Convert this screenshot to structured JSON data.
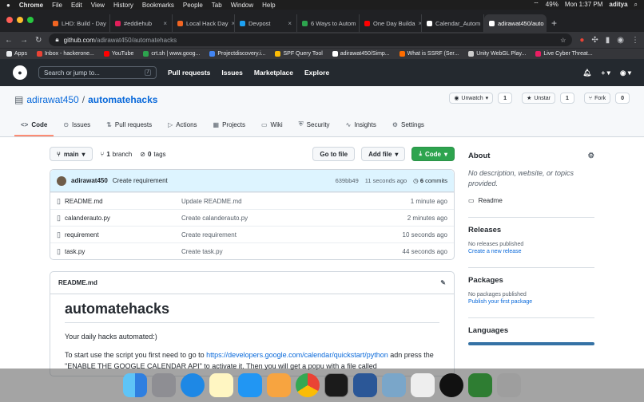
{
  "menubar": {
    "app": "Chrome",
    "items": [
      "File",
      "Edit",
      "View",
      "History",
      "Bookmarks",
      "People",
      "Tab",
      "Window",
      "Help"
    ],
    "battery": "49%",
    "clock": "Mon 1:37 PM",
    "user": "aditya"
  },
  "tabs": [
    {
      "label": "LHD: Build - Day",
      "color": "#f26522"
    },
    {
      "label": "#eddiehub",
      "color": "#e01e5a"
    },
    {
      "label": "Local Hack Day",
      "color": "#f26522"
    },
    {
      "label": "Devpost",
      "color": "#003e54"
    },
    {
      "label": "6 Ways to Autom",
      "color": "#2da44e"
    },
    {
      "label": "One Day Builda",
      "color": "#ff0000"
    },
    {
      "label": "Calendar_Autom",
      "color": "#ffffff"
    },
    {
      "label": "adirawat450/auto",
      "color": "#ffffff",
      "active": true
    }
  ],
  "url": {
    "host": "github.com",
    "path": "/adirawat450/automatehacks"
  },
  "bookmarks": [
    {
      "label": "Apps",
      "color": "#e8eaed"
    },
    {
      "label": "Inbox - hackerone...",
      "color": "#ea4335"
    },
    {
      "label": "YouTube",
      "color": "#ff0000"
    },
    {
      "label": "crt.sh | www.goog...",
      "color": "#2da44e"
    },
    {
      "label": "Projectdiscovery.i...",
      "color": "#4285f4"
    },
    {
      "label": "SPF Query Tool",
      "color": "#fbbc05"
    },
    {
      "label": "adirawat450/Simp...",
      "color": "#ffffff"
    },
    {
      "label": "What is SSRF (Ser...",
      "color": "#ff6d00"
    },
    {
      "label": "Unity WebGL Play...",
      "color": "#cccccc"
    },
    {
      "label": "Live Cyber Threat...",
      "color": "#e91e63"
    }
  ],
  "github": {
    "search_placeholder": "Search or jump to...",
    "search_key": "/",
    "nav": [
      "Pull requests",
      "Issues",
      "Marketplace",
      "Explore"
    ],
    "plus": "+"
  },
  "repo": {
    "owner": "adirawat450",
    "name": "automatehacks",
    "watch": "Unwatch",
    "watch_count": "1",
    "star": "Unstar",
    "star_count": "1",
    "fork": "Fork",
    "fork_count": "0"
  },
  "repo_tabs": [
    {
      "label": "Code",
      "icon": "<>",
      "active": true
    },
    {
      "label": "Issues",
      "icon": "⊙"
    },
    {
      "label": "Pull requests",
      "icon": "⇅"
    },
    {
      "label": "Actions",
      "icon": "▷"
    },
    {
      "label": "Projects",
      "icon": "▦"
    },
    {
      "label": "Wiki",
      "icon": "▭"
    },
    {
      "label": "Security",
      "icon": "⛨"
    },
    {
      "label": "Insights",
      "icon": "∿"
    },
    {
      "label": "Settings",
      "icon": "⚙"
    }
  ],
  "branchbar": {
    "branch": "main",
    "branches_count": "1",
    "branches_label": "branch",
    "tags_count": "0",
    "tags_label": "tags",
    "goto": "Go to file",
    "add": "Add file",
    "code": "Code"
  },
  "commit": {
    "author": "adirawat450",
    "message": "Create requirement",
    "sha": "639bb49",
    "time": "11 seconds ago",
    "count": "6",
    "count_label": "commits"
  },
  "files": [
    {
      "name": "README.md",
      "msg": "Update README.md",
      "time": "1 minute ago"
    },
    {
      "name": "calanderauto.py",
      "msg": "Create calanderauto.py",
      "time": "2 minutes ago"
    },
    {
      "name": "requirement",
      "msg": "Create requirement",
      "time": "10 seconds ago"
    },
    {
      "name": "task.py",
      "msg": "Create task.py",
      "time": "44 seconds ago"
    }
  ],
  "readme": {
    "file": "README.md",
    "title": "automatehacks",
    "p1": "Your daily hacks automated:)",
    "p2a": "To start use the script you first need to go to ",
    "p2link": "https://developers.google.com/calendar/quickstart/python",
    "p2b": " adn press the \"ENABLE THE GOOGLE CALENDAR API\" to activate it. Then you will get a popu with a file called"
  },
  "about": {
    "title": "About",
    "desc": "No description, website, or topics provided.",
    "readme": "Readme"
  },
  "releases": {
    "title": "Releases",
    "none": "No releases published",
    "link": "Create a new release"
  },
  "packages": {
    "title": "Packages",
    "none": "No packages published",
    "link": "Publish your first package"
  },
  "languages": {
    "title": "Languages"
  }
}
